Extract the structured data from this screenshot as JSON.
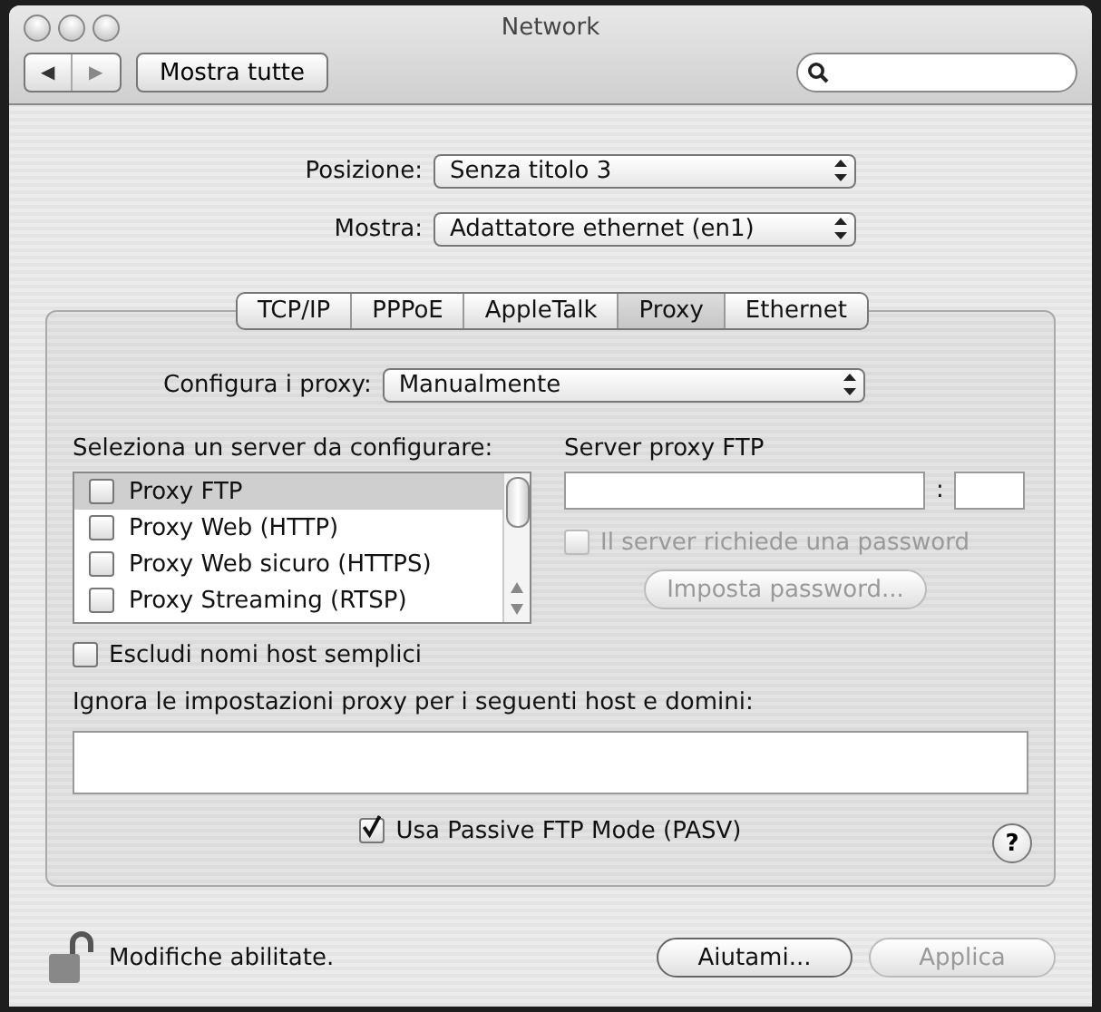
{
  "window": {
    "title": "Network"
  },
  "toolbar": {
    "back": "◀",
    "forward": "▶",
    "show_all": "Mostra tutte"
  },
  "location": {
    "label": "Posizione:",
    "value": "Senza titolo 3"
  },
  "show": {
    "label": "Mostra:",
    "value": "Adattatore ethernet (en1)"
  },
  "tabs": [
    {
      "label": "TCP/IP",
      "selected": false
    },
    {
      "label": "PPPoE",
      "selected": false
    },
    {
      "label": "AppleTalk",
      "selected": false
    },
    {
      "label": "Proxy",
      "selected": true
    },
    {
      "label": "Ethernet",
      "selected": false
    }
  ],
  "configure": {
    "label": "Configura i proxy:",
    "value": "Manualmente"
  },
  "servers": {
    "label": "Seleziona un server da configurare:",
    "items": [
      {
        "label": "Proxy FTP",
        "checked": false,
        "selected": true
      },
      {
        "label": "Proxy Web (HTTP)",
        "checked": false,
        "selected": false
      },
      {
        "label": "Proxy Web sicuro (HTTPS)",
        "checked": false,
        "selected": false
      },
      {
        "label": "Proxy Streaming (RTSP)",
        "checked": false,
        "selected": false
      }
    ]
  },
  "server_detail": {
    "title": "Server proxy FTP",
    "separator": ":",
    "requires_password": {
      "label": "Il server richiede una password",
      "checked": false,
      "disabled": true
    },
    "set_password": {
      "label": "Imposta password...",
      "disabled": true
    }
  },
  "exclude_simple": {
    "label": "Escludi nomi host semplici",
    "checked": false
  },
  "bypass": {
    "label": "Ignora le impostazioni proxy per i seguenti host e domini:"
  },
  "passive_ftp": {
    "label": "Usa Passive FTP Mode (PASV)",
    "checked": true
  },
  "help": "?",
  "footer": {
    "lock_text": "Modifiche abilitate.",
    "buttons": [
      {
        "label": "Aiutami...",
        "disabled": false
      },
      {
        "label": "Applica",
        "disabled": true
      }
    ]
  }
}
